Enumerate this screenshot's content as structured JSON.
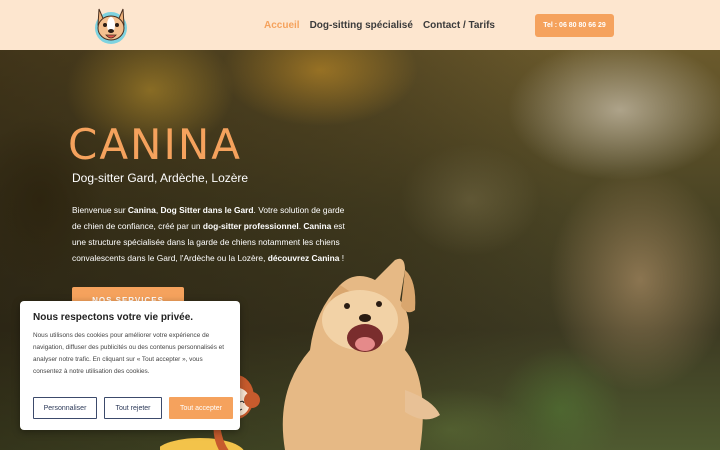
{
  "header": {
    "logo_icon": "french-bulldog-logo",
    "nav": [
      {
        "label": "Accueil",
        "active": true
      },
      {
        "label": "Dog-sitting spécialisé",
        "active": false
      },
      {
        "label": "Contact / Tarifs",
        "active": false
      }
    ],
    "phone_button": "Tel : 06 80 80 66 29"
  },
  "hero": {
    "title": "CANINA",
    "subtitle": "Dog-sitter Gard, Ardèche, Lozère",
    "text": {
      "p1": "Bienvenue sur ",
      "b1": "Canina",
      "p2": ", ",
      "b2": "Dog Sitter dans le Gard",
      "p3": ". Votre solution de garde de chien de confiance, créé par un ",
      "b3": "dog-sitter professionnel",
      "p4": ". ",
      "b4": "Canina",
      "p5": " est une structure spécialisée dans la garde de chiens notamment les chiens convalescents dans le Gard, l'Ardèche ou la Lozère, ",
      "b5": "découvrez Canina",
      "p6": " !"
    },
    "cta_label": "NOS SERVICES"
  },
  "cookie": {
    "title": "Nous respectons votre vie privée.",
    "text": "Nous utilisons des cookies pour améliorer votre expérience de navigation, diffuser des publicités ou des contenus personnalisés et analyser notre trafic. En cliquant sur « Tout accepter », vous consentez à notre utilisation des cookies.",
    "buttons": {
      "customize": "Personnaliser",
      "reject": "Tout rejeter",
      "accept": "Tout accepter"
    }
  },
  "colors": {
    "accent": "#f5a25d",
    "header_bg": "#fde6cf",
    "button_outline": "#3c4a6b"
  }
}
